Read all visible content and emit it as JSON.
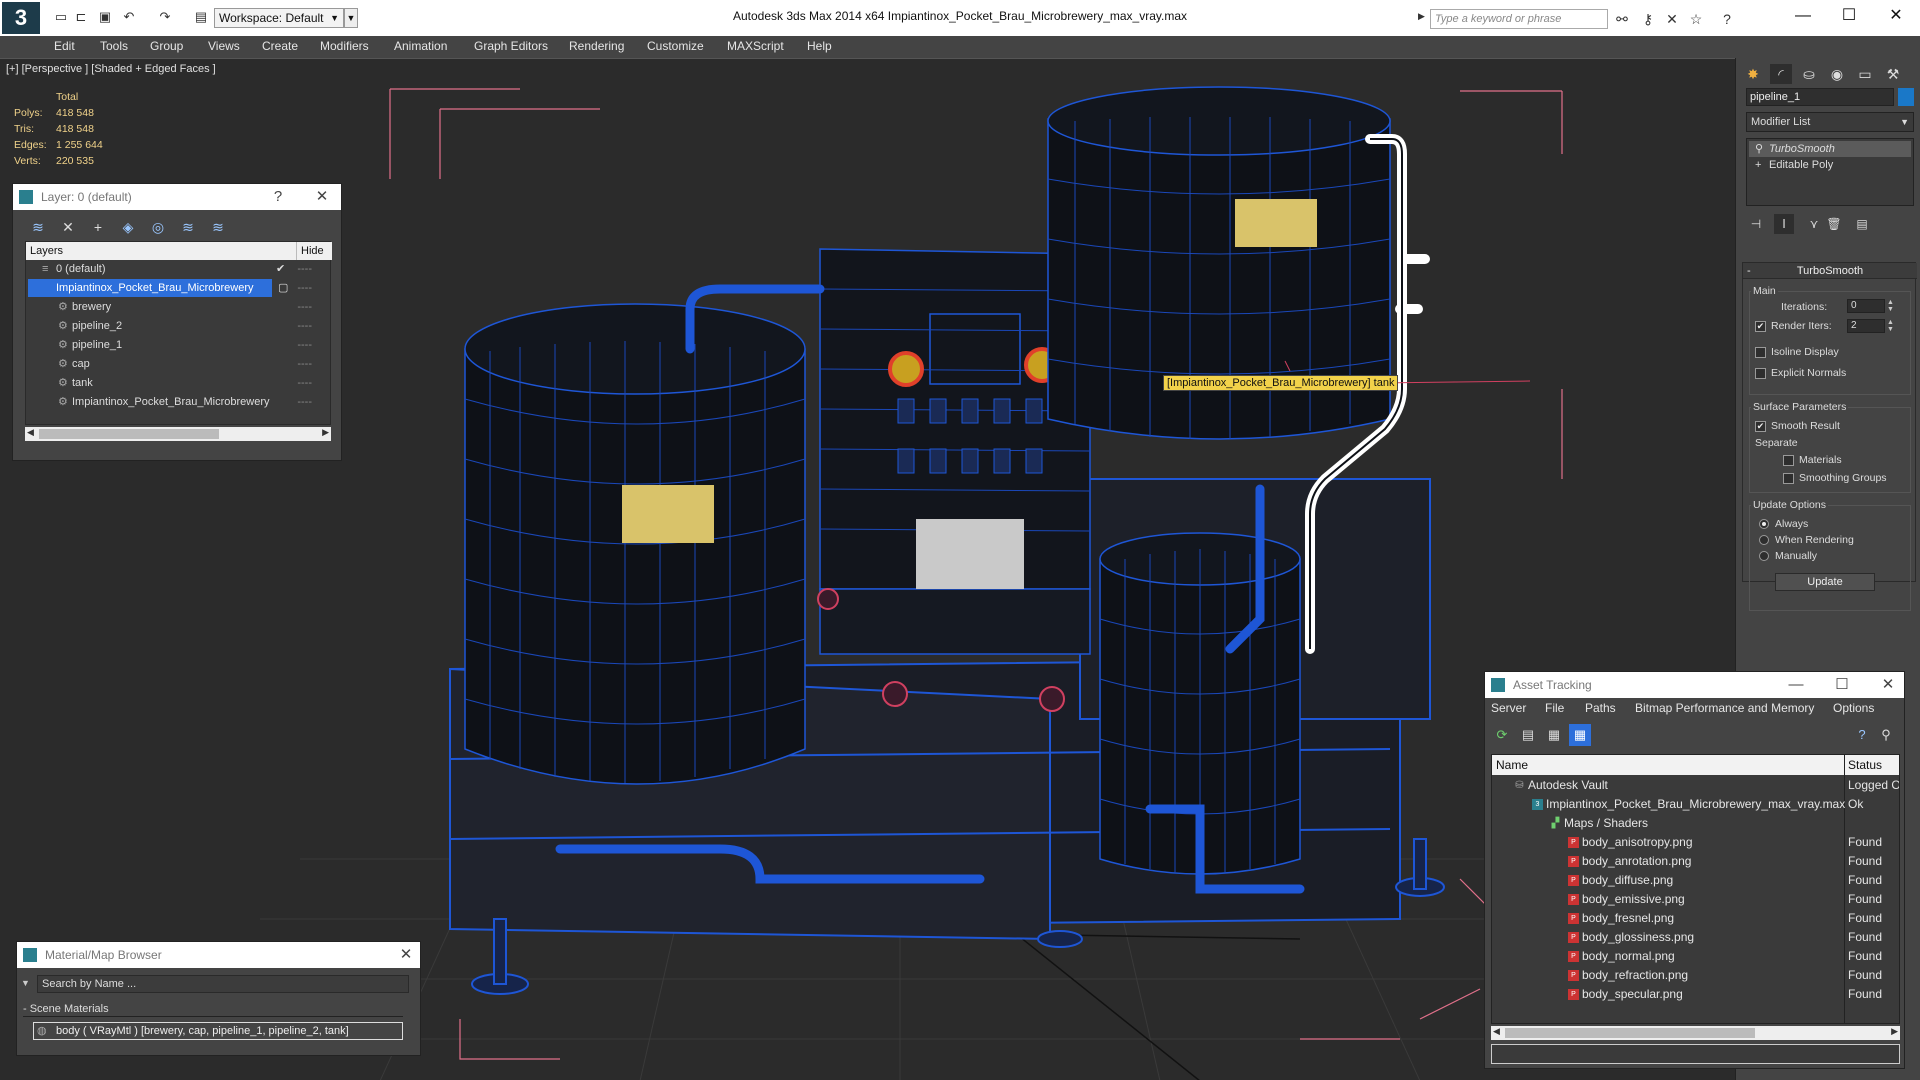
{
  "app": {
    "title": "Autodesk 3ds Max  2014 x64     Impiantinox_Pocket_Brau_Microbrewery_max_vray.max",
    "logo_text": "3",
    "workspace": "Workspace: Default",
    "search_placeholder": "Type a keyword or phrase",
    "quick_access_icons": [
      "new-file-icon",
      "open-file-icon",
      "save-file-icon",
      "undo-icon",
      "redo-icon",
      "project-folder-icon"
    ],
    "help_icons": [
      "binoculars-icon",
      "key-icon",
      "autodesk-exchange-icon",
      "star-icon",
      "help-icon"
    ],
    "window_controls": [
      "minimize-icon",
      "maximize-icon",
      "close-icon"
    ]
  },
  "menu": [
    "Edit",
    "Tools",
    "Group",
    "Views",
    "Create",
    "Modifiers",
    "Animation",
    "Graph Editors",
    "Rendering",
    "Customize",
    "MAXScript",
    "Help"
  ],
  "viewport": {
    "label": "[+] [Perspective ] [Shaded + Edged Faces ]",
    "stats": {
      "header": "Total",
      "rows": [
        {
          "label": "Polys:",
          "value": "418 548"
        },
        {
          "label": "Tris:",
          "value": "418 548"
        },
        {
          "label": "Edges:",
          "value": "1 255 644"
        },
        {
          "label": "Verts:",
          "value": "220 535"
        }
      ]
    },
    "tooltip": "[Impiantinox_Pocket_Brau_Microbrewery] tank",
    "wire_color": "#1e56d6",
    "select_color": "#ffffff",
    "bbox_color": "#e0708a"
  },
  "layer_panel": {
    "title": "Layer: 0 (default)",
    "help": "?",
    "tools": [
      "layer-create-icon",
      "delete-icon",
      "add-icon",
      "select-objects-icon",
      "highlight-icon",
      "hide-all-icon",
      "freeze-all-icon"
    ],
    "col_layers": "Layers",
    "col_hide": "Hide",
    "rows": [
      {
        "name": "0 (default)",
        "indent": 1,
        "mark": "✔"
      },
      {
        "name": "Impiantinox_Pocket_Brau_Microbrewery",
        "indent": 1,
        "mark": "▢",
        "selected": true
      },
      {
        "name": "brewery",
        "indent": 2
      },
      {
        "name": "pipeline_2",
        "indent": 2
      },
      {
        "name": "pipeline_1",
        "indent": 2
      },
      {
        "name": "cap",
        "indent": 2
      },
      {
        "name": "tank",
        "indent": 2
      },
      {
        "name": "Impiantinox_Pocket_Brau_Microbrewery",
        "indent": 2
      }
    ],
    "row_dots": "----"
  },
  "material_browser": {
    "title": "Material/Map Browser",
    "search_placeholder": "Search by Name ...",
    "section": "- Scene Materials",
    "material": "body  ( VRayMtl )  [brewery, cap, pipeline_1, pipeline_2, tank]"
  },
  "command_panel": {
    "tabs": [
      "create-icon",
      "modify-icon",
      "hierarchy-icon",
      "motion-icon",
      "display-icon",
      "utilities-icon"
    ],
    "object_name": "pipeline_1",
    "object_color": "#1a78c8",
    "modifier_list": "Modifier List",
    "stack": [
      {
        "name": "TurboSmooth",
        "active": true
      },
      {
        "name": "Editable Poly",
        "active": false
      }
    ],
    "stack_tools": [
      "pin-stack-icon",
      "show-end-result-icon",
      "make-unique-icon",
      "remove-modifier-icon",
      "configure-sets-icon"
    ],
    "rollout": {
      "title": "TurboSmooth",
      "main": "Main",
      "iterations_label": "Iterations:",
      "iterations": "0",
      "render_iters_label": "Render Iters:",
      "render_iters": "2",
      "render_iters_checked": true,
      "isoline": "Isoline Display",
      "explicit_normals": "Explicit Normals",
      "surface_params": "Surface Parameters",
      "smooth_result": "Smooth Result",
      "smooth_result_checked": true,
      "separate": "Separate",
      "materials": "Materials",
      "smoothing_groups": "Smoothing Groups",
      "update_options": "Update Options",
      "always": "Always",
      "when_rendering": "When Rendering",
      "manually": "Manually",
      "selected_update": "Always",
      "update_button": "Update"
    }
  },
  "asset_tracking": {
    "title": "Asset Tracking",
    "menu": [
      "Server",
      "File",
      "Paths",
      "Bitmap Performance and Memory",
      "Options"
    ],
    "tools": [
      "refresh-icon",
      "list-view-icon",
      "thumbnail-view-icon",
      "table-view-icon"
    ],
    "right_tools": [
      "help-icon",
      "pin-icon"
    ],
    "col_name": "Name",
    "col_status": "Status",
    "rows": [
      {
        "name": "Autodesk Vault",
        "status": "Logged O",
        "indent": 1,
        "icon": "vault-icon"
      },
      {
        "name": "Impiantinox_Pocket_Brau_Microbrewery_max_vray.max",
        "status": "Ok",
        "indent": 2,
        "icon": "max-file-icon"
      },
      {
        "name": "Maps / Shaders",
        "status": "",
        "indent": 3,
        "icon": "maps-icon"
      },
      {
        "name": "body_anisotropy.png",
        "status": "Found",
        "indent": 4,
        "icon": "png-icon"
      },
      {
        "name": "body_anrotation.png",
        "status": "Found",
        "indent": 4,
        "icon": "png-icon"
      },
      {
        "name": "body_diffuse.png",
        "status": "Found",
        "indent": 4,
        "icon": "png-icon"
      },
      {
        "name": "body_emissive.png",
        "status": "Found",
        "indent": 4,
        "icon": "png-icon"
      },
      {
        "name": "body_fresnel.png",
        "status": "Found",
        "indent": 4,
        "icon": "png-icon"
      },
      {
        "name": "body_glossiness.png",
        "status": "Found",
        "indent": 4,
        "icon": "png-icon"
      },
      {
        "name": "body_normal.png",
        "status": "Found",
        "indent": 4,
        "icon": "png-icon"
      },
      {
        "name": "body_refraction.png",
        "status": "Found",
        "indent": 4,
        "icon": "png-icon"
      },
      {
        "name": "body_specular.png",
        "status": "Found",
        "indent": 4,
        "icon": "png-icon"
      }
    ]
  }
}
